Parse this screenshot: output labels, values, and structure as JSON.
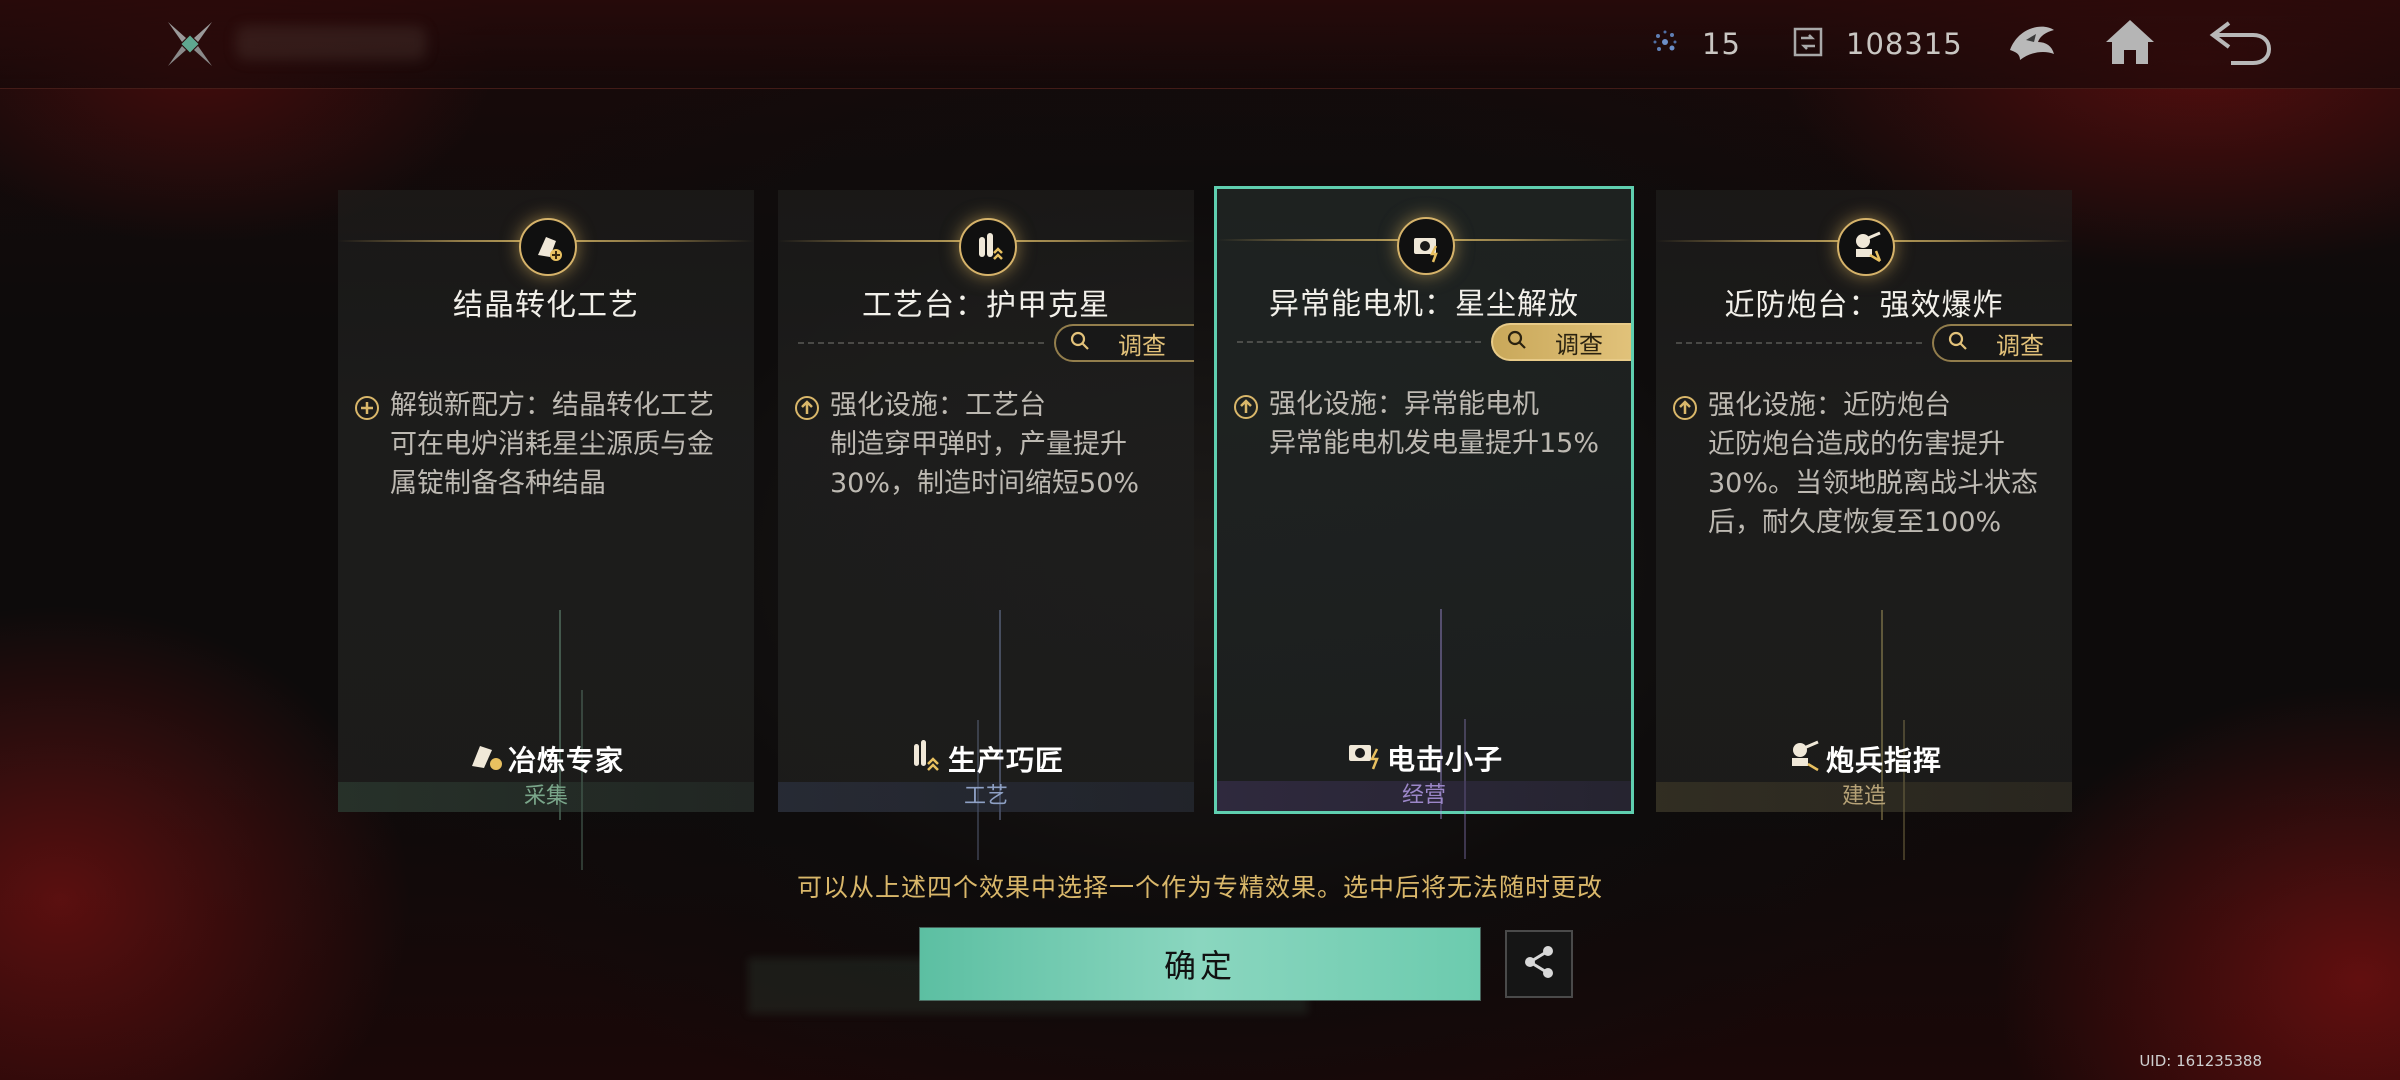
{
  "header": {
    "logo_icon": "crossed-blades-icon",
    "resources": [
      {
        "icon": "stardust-icon",
        "value": "15"
      },
      {
        "icon": "exchange-icon",
        "value": "108315"
      }
    ],
    "buttons": [
      "emblem-icon",
      "home-icon",
      "back-icon"
    ]
  },
  "cards": [
    {
      "title": "结晶转化工艺",
      "has_investigate": false,
      "desc_icon": "plus-circle-icon",
      "description": "解锁新配方：结晶转化工艺\n可在电炉消耗星尘源质与金\n属锭制备各种结晶",
      "role": "冶炼专家",
      "category": "采集",
      "selected": false
    },
    {
      "title": "工艺台：护甲克星",
      "has_investigate": true,
      "investigate_label": "调查",
      "desc_icon": "upgrade-arrow-icon",
      "description": "强化设施：工艺台\n制造穿甲弹时，产量提升\n30%，制造时间缩短50%",
      "role": "生产巧匠",
      "category": "工艺",
      "selected": false
    },
    {
      "title": "异常能电机：星尘解放",
      "has_investigate": true,
      "investigate_label": "调查",
      "desc_icon": "upgrade-arrow-icon",
      "description": "强化设施：异常能电机\n异常能电机发电量提升15%",
      "role": "电击小子",
      "category": "经营",
      "selected": true
    },
    {
      "title": "近防炮台：强效爆炸",
      "has_investigate": true,
      "investigate_label": "调查",
      "desc_icon": "upgrade-arrow-icon",
      "description": "强化设施：近防炮台\n近防炮台造成的伤害提升\n30%。当领地脱离战斗状态\n后，耐久度恢复至100%",
      "role": "炮兵指挥",
      "category": "建造",
      "selected": false
    }
  ],
  "notice": "可以从上述四个效果中选择一个作为专精效果。选中后将无法随时更改",
  "confirm_label": "确定",
  "share_icon": "share-icon",
  "uid": "UID: 161235388",
  "colors": {
    "selected_border": "#5fcfb0",
    "confirm_bg": "#7ad0b6",
    "gold": "#d9b76a"
  }
}
